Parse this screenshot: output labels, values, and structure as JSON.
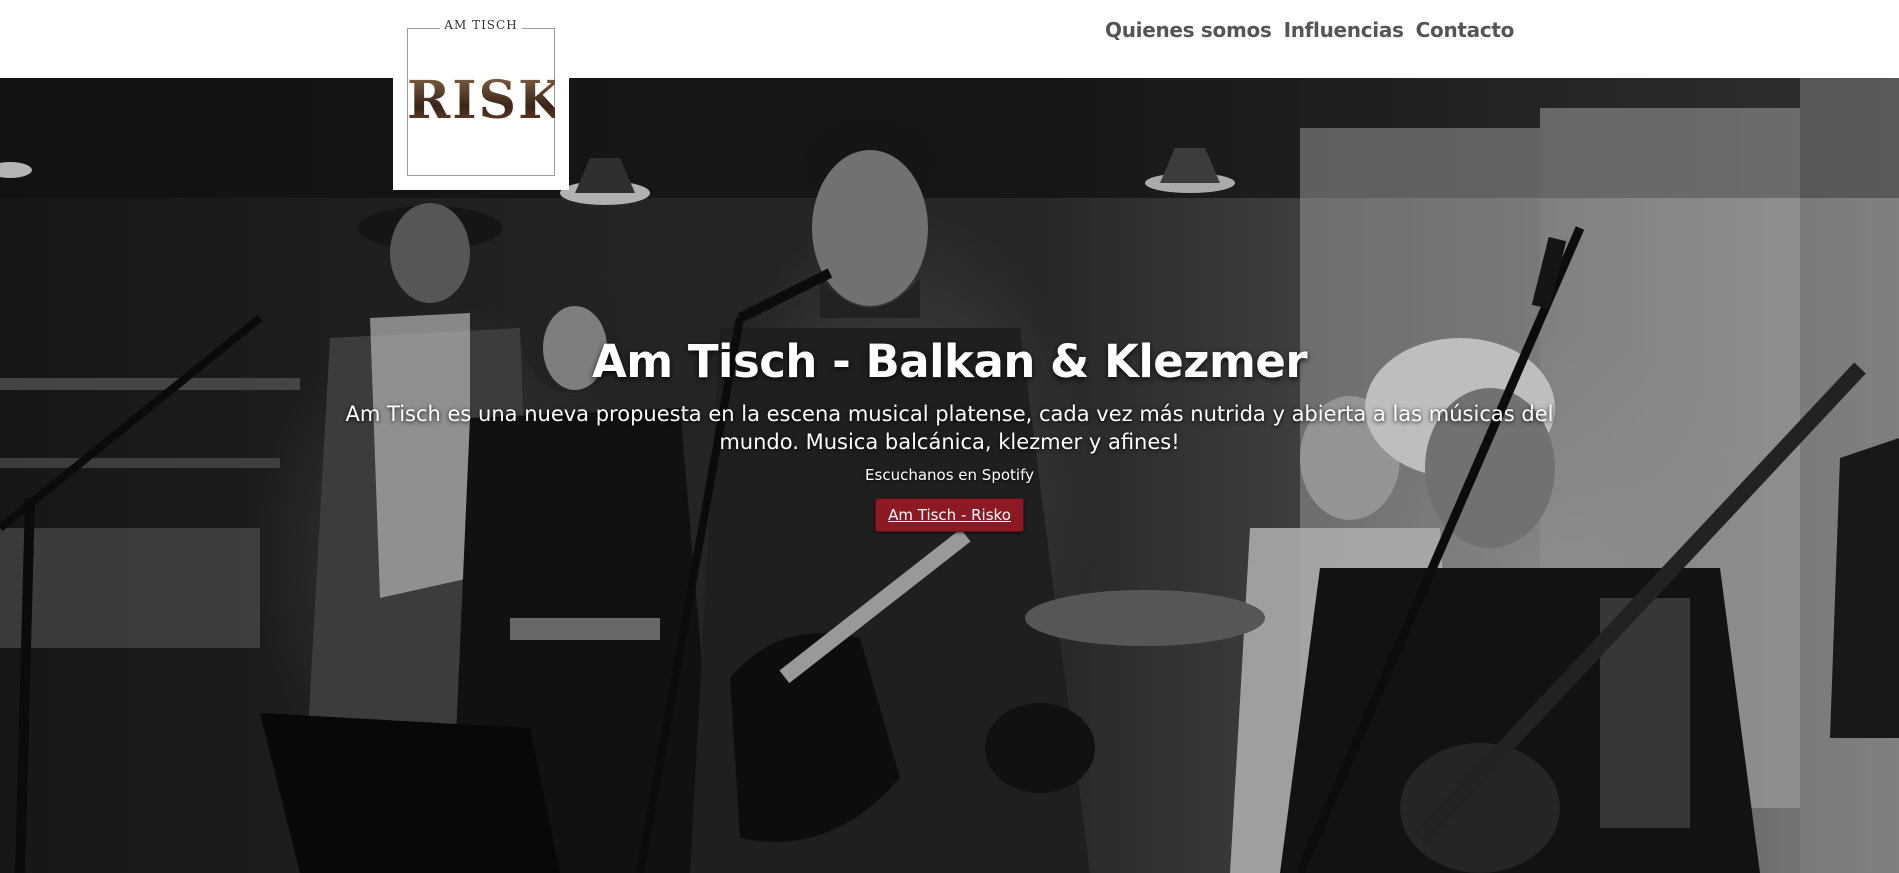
{
  "nav": {
    "items": [
      {
        "label": "Quienes somos"
      },
      {
        "label": "Influencias"
      },
      {
        "label": "Contacto"
      }
    ]
  },
  "logo": {
    "small_text": "AM TISCH",
    "big_text": "RISKO"
  },
  "hero": {
    "title": "Am Tisch - Balkan & Klezmer",
    "description": "Am Tisch es una nueva propuesta en la escena musical platense, cada vez más nutrida y abierta a las músicas del mundo. Musica balcánica, klezmer y afines!",
    "spotify_text": "Escuchanos en Spotify",
    "button_label": "Am Tisch - Risko",
    "button_color": "#8b1a24"
  }
}
